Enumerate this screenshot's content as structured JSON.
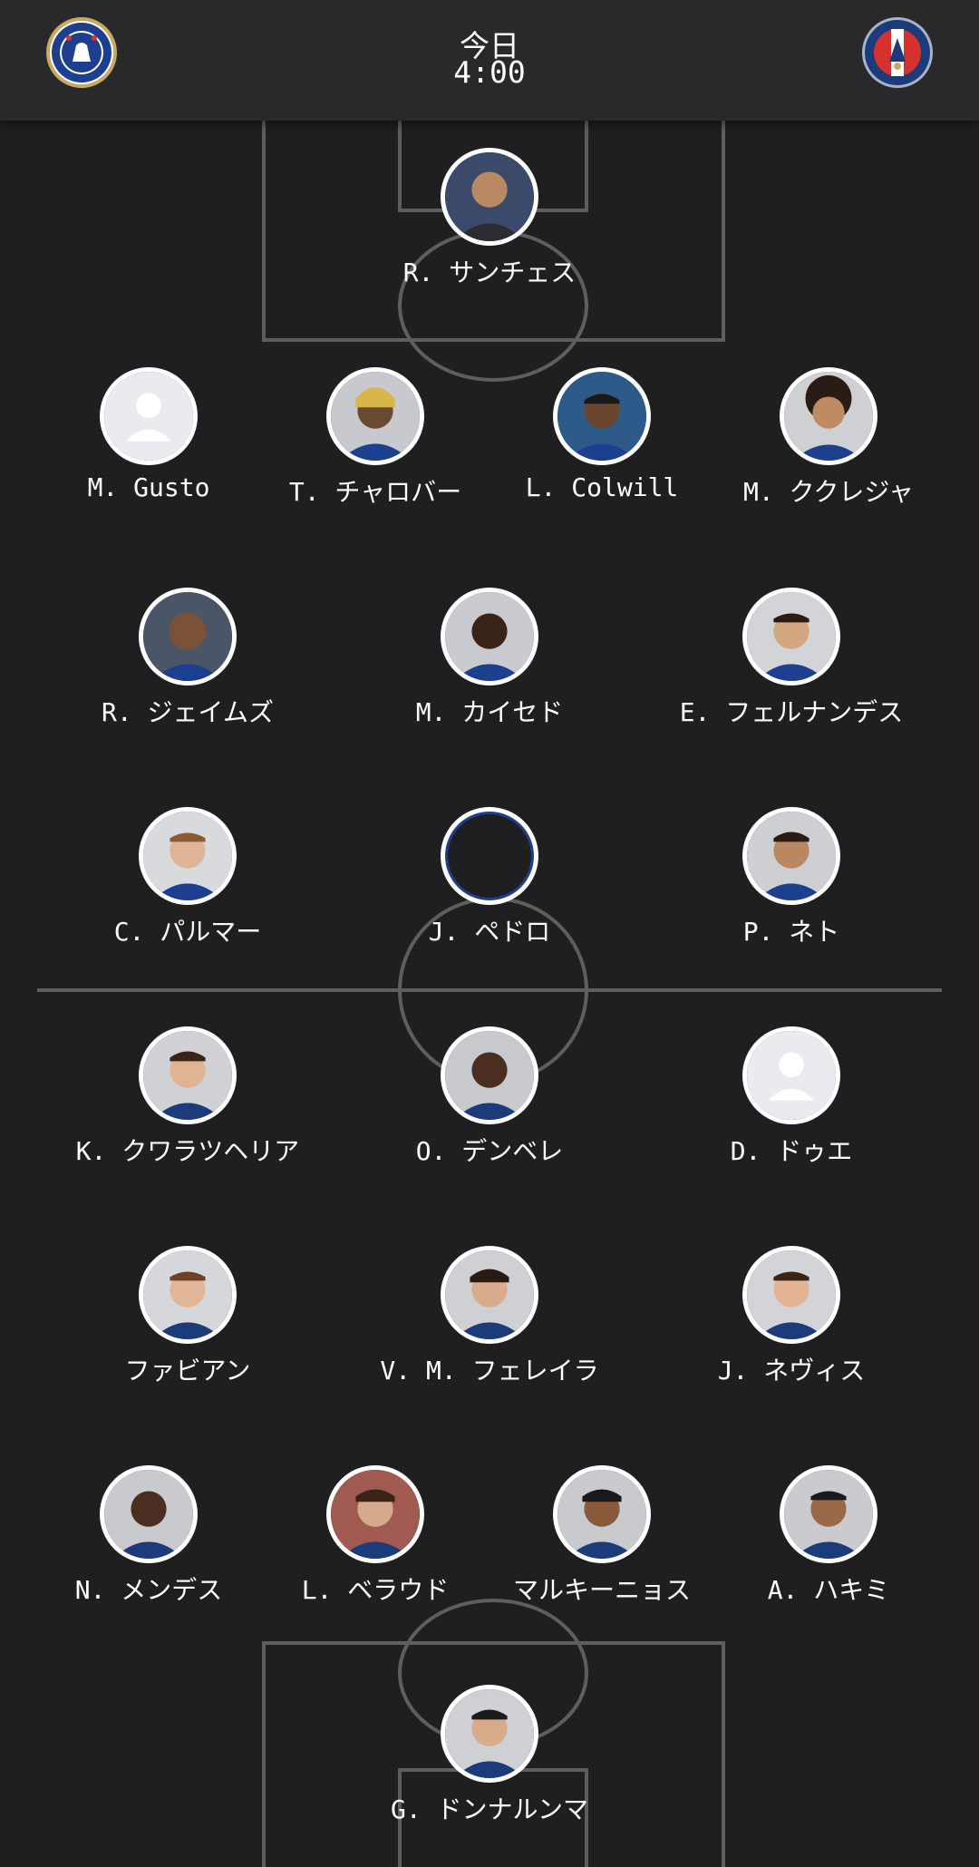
{
  "match": {
    "day": "今日",
    "time": "4:00"
  },
  "home_team": {
    "crest_icon": "chelsea-crest-icon",
    "accent": "#1d3f8f",
    "players": [
      {
        "name": "R. サンチェス",
        "photo": true
      },
      {
        "name": "M. Gusto",
        "photo": false
      },
      {
        "name": "T. チャロバー",
        "photo": true
      },
      {
        "name": "L. Colwill",
        "photo": true
      },
      {
        "name": "M. ククレジャ",
        "photo": true
      },
      {
        "name": "R. ジェイムズ",
        "photo": true
      },
      {
        "name": "M. カイセド",
        "photo": true
      },
      {
        "name": "E. フェルナンデス",
        "photo": true
      },
      {
        "name": "C. パルマー",
        "photo": true
      },
      {
        "name": "J. ペドロ",
        "photo": false
      },
      {
        "name": "P. ネト",
        "photo": true
      }
    ]
  },
  "away_team": {
    "crest_icon": "psg-crest-icon",
    "accent": "#1b3b7a",
    "players": [
      {
        "name": "K. クワラツヘリア",
        "photo": true
      },
      {
        "name": "O. デンベレ",
        "photo": true
      },
      {
        "name": "D. ドゥエ",
        "photo": false
      },
      {
        "name": "ファビアン",
        "photo": true
      },
      {
        "name": "V. M. フェレイラ",
        "photo": true
      },
      {
        "name": "J. ネヴィス",
        "photo": true
      },
      {
        "name": "N. メンデス",
        "photo": true
      },
      {
        "name": "L. ベラウド",
        "photo": true
      },
      {
        "name": "マルキーニョス",
        "photo": true
      },
      {
        "name": "A. ハキミ",
        "photo": true
      },
      {
        "name": "G. ドンナルンマ",
        "photo": true
      }
    ]
  },
  "colors": {
    "background": "#1f1f21",
    "header": "#29292c",
    "pitch_lines": "#5a5a5c"
  }
}
